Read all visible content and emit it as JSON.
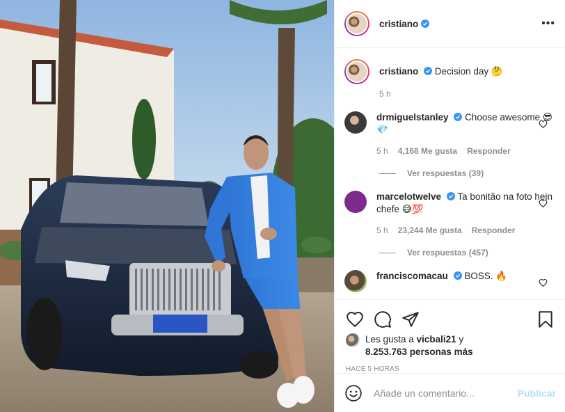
{
  "post": {
    "author": "cristiano",
    "caption": "Decision day 🤔",
    "caption_time": "5 h"
  },
  "comments": [
    {
      "user": "drmiguelstanley",
      "text": "Choose awesome 😎💎",
      "time": "5 h",
      "likes": "4,168 Me gusta",
      "reply": "Responder",
      "view_replies": "Ver respuestas (39)"
    },
    {
      "user": "marcelotwelve",
      "text": "Ta bonitão na foto hein chefe 😅💯",
      "time": "5 h",
      "likes": "23,244 Me gusta",
      "reply": "Responder",
      "view_replies": "Ver respuestas (457)"
    },
    {
      "user": "franciscomacau",
      "text": "BOSS. 🔥"
    }
  ],
  "actions": {
    "liked_prefix": "Les gusta a",
    "liked_user": "vicbali21",
    "liked_and": "y",
    "liked_count": "8.253.763 personas más",
    "time_ago": "HACE 5 HORAS"
  },
  "composer": {
    "placeholder": "Añade un comentario...",
    "publish_label": "Publicar"
  },
  "icons": {
    "more": "more-options-icon",
    "like": "heart-icon",
    "comment": "comment-icon",
    "share": "share-icon",
    "save": "bookmark-icon",
    "emoji": "emoji-icon",
    "verified": "verified-badge-icon"
  },
  "colors": {
    "verified": "#3897f0",
    "publish_disabled": "#b2dffc",
    "muted": "#8e8e8e",
    "text": "#262626"
  }
}
